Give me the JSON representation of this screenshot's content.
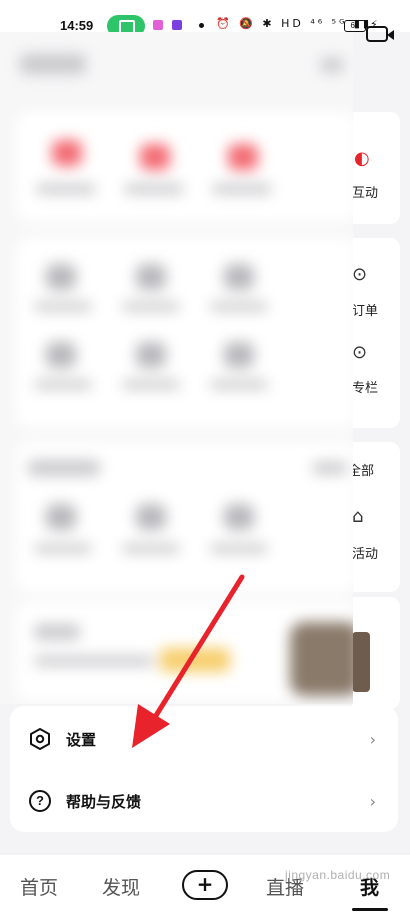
{
  "status_bar": {
    "time": "14:59",
    "icons_text": "⏰ 🔕 ✱ HD ⁴⁶ ⁵ᴳ ▮▮",
    "battery": "61"
  },
  "background_page": {
    "right_labels": [
      "互动",
      "订单",
      "专栏",
      "全部",
      "活动"
    ]
  },
  "menu": {
    "items": [
      {
        "label": "设置",
        "icon": "settings-hexagon-icon"
      },
      {
        "label": "帮助与反馈",
        "icon": "help-question-icon"
      }
    ]
  },
  "tabs": {
    "items": [
      {
        "label": "首页"
      },
      {
        "label": "发现"
      },
      {
        "label": "+"
      },
      {
        "label": "直播"
      },
      {
        "label": "我"
      }
    ],
    "active": "我"
  },
  "watermark": "jingyan.baidu.com",
  "colors": {
    "accent_arrow": "#e8232b",
    "status_pill": "#2ec46a"
  }
}
